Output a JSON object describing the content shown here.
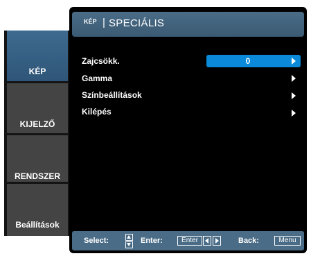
{
  "header": {
    "small_label": "KÉP",
    "separator": "|",
    "title": "SPECIÁLIS"
  },
  "sidebar": {
    "tabs": [
      {
        "label": "KÉP",
        "active": true
      },
      {
        "label": "KIJELZŐ",
        "active": false
      },
      {
        "label": "RENDSZER",
        "active": false
      },
      {
        "label": "Beállítások",
        "active": false
      }
    ]
  },
  "menu": {
    "items": [
      {
        "label": "Zajcsökk.",
        "value": "0",
        "selected": true
      },
      {
        "label": "Gamma"
      },
      {
        "label": "Színbeállítások"
      },
      {
        "label": "Kilépés"
      }
    ]
  },
  "footer": {
    "select_label": "Select:",
    "enter_label": "Enter:",
    "enter_key": "Enter",
    "back_label": "Back:",
    "back_key": "Menu"
  },
  "colors": {
    "accent": "#0a8ad8",
    "header": "#4a6c86",
    "active_tab": "#3d6a8f",
    "inactive_tab": "#444444"
  }
}
